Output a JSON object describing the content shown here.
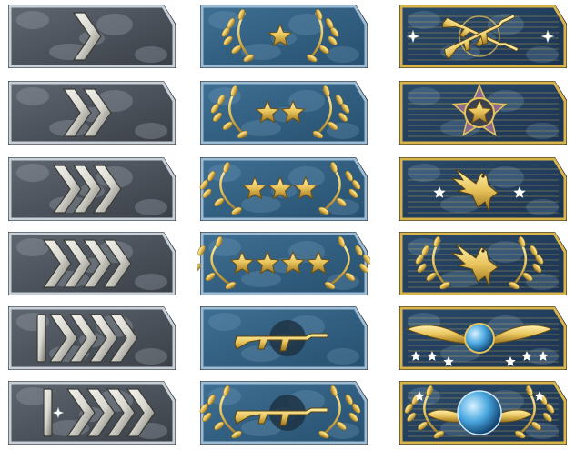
{
  "ranks": [
    {
      "column": "silver",
      "emblem": "chevrons",
      "chevrons": 1,
      "bar": false,
      "star": false
    },
    {
      "column": "silver",
      "emblem": "chevrons",
      "chevrons": 2,
      "bar": false,
      "star": false
    },
    {
      "column": "silver",
      "emblem": "chevrons",
      "chevrons": 3,
      "bar": false,
      "star": false
    },
    {
      "column": "silver",
      "emblem": "chevrons",
      "chevrons": 4,
      "bar": false,
      "star": false
    },
    {
      "column": "silver",
      "emblem": "chevrons",
      "chevrons": 4,
      "bar": true,
      "star": false
    },
    {
      "column": "silver",
      "emblem": "chevrons",
      "chevrons": 4,
      "bar": true,
      "star": true
    },
    {
      "column": "gold-nova",
      "emblem": "stars-wreath",
      "stars": 1
    },
    {
      "column": "gold-nova",
      "emblem": "stars-wreath",
      "stars": 2
    },
    {
      "column": "gold-nova",
      "emblem": "stars-wreath",
      "stars": 3
    },
    {
      "column": "gold-nova",
      "emblem": "stars-wreath",
      "stars": 4
    },
    {
      "column": "gold-nova",
      "emblem": "rifle"
    },
    {
      "column": "gold-nova",
      "emblem": "rifle-wreath"
    },
    {
      "column": "elite",
      "emblem": "crossed-rifles"
    },
    {
      "column": "elite",
      "emblem": "star-medal"
    },
    {
      "column": "elite",
      "emblem": "eagle"
    },
    {
      "column": "elite",
      "emblem": "eagle-wreath"
    },
    {
      "column": "elite",
      "emblem": "winged-globe-stars"
    },
    {
      "column": "elite",
      "emblem": "globe-wreath"
    }
  ],
  "colors": {
    "silver_plate": "#5f6670",
    "silver_plate_dark": "#3a3f47",
    "blue_plate": "#3e6f93",
    "blue_plate_dark": "#27506f",
    "elite_plate": "#2a4a6a",
    "border_silver": "#c9cfd6",
    "border_blue": "#9dbbd3",
    "border_gold": "#d9b44a",
    "gold": "#e8c35a",
    "gold_dark": "#9a7420",
    "chevron": "#d8d8d0",
    "chevron_dark": "#6e6e66",
    "globe": "#4aa8e0"
  }
}
